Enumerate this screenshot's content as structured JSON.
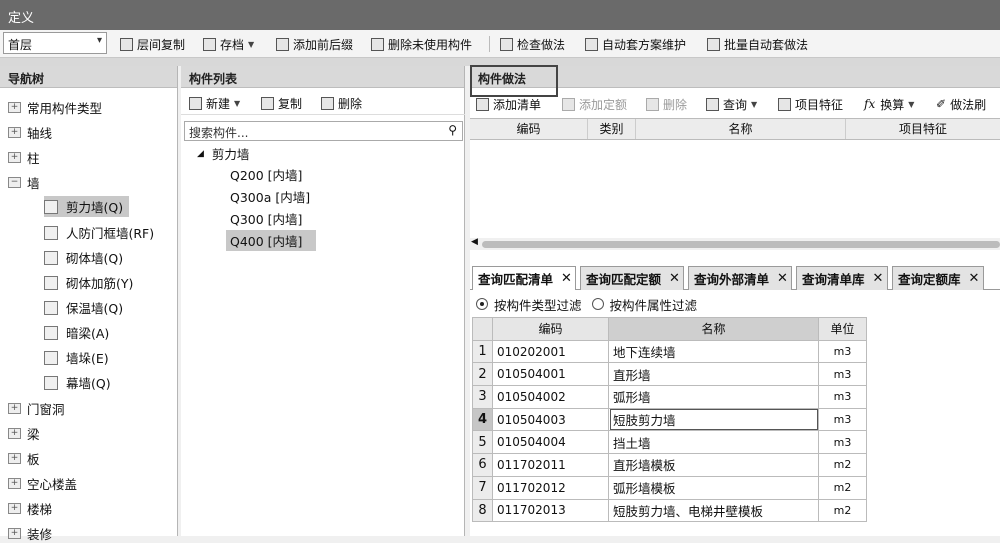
{
  "window": {
    "title": "定义"
  },
  "toolbar": {
    "floor": "首层",
    "items": [
      {
        "label": "层间复制",
        "dropdown": false
      },
      {
        "label": "存档",
        "dropdown": true
      },
      {
        "label": "添加前后缀",
        "dropdown": false
      },
      {
        "label": "删除未使用构件",
        "dropdown": false
      },
      {
        "label": "检查做法",
        "dropdown": false
      },
      {
        "label": "自动套方案维护",
        "dropdown": false
      },
      {
        "label": "批量自动套做法",
        "dropdown": false
      }
    ]
  },
  "nav": {
    "title": "导航树",
    "items": [
      {
        "label": "常用构件类型"
      },
      {
        "label": "轴线"
      },
      {
        "label": "柱"
      },
      {
        "label": "墙"
      },
      {
        "label": "剪力墙(Q)",
        "child": true,
        "selected": true
      },
      {
        "label": "人防门框墙(RF)",
        "child": true
      },
      {
        "label": "砌体墙(Q)",
        "child": true
      },
      {
        "label": "砌体加筋(Y)",
        "child": true
      },
      {
        "label": "保温墙(Q)",
        "child": true
      },
      {
        "label": "暗梁(A)",
        "child": true
      },
      {
        "label": "墙垛(E)",
        "child": true
      },
      {
        "label": "幕墙(Q)",
        "child": true
      },
      {
        "label": "门窗洞"
      },
      {
        "label": "梁"
      },
      {
        "label": "板"
      },
      {
        "label": "空心楼盖"
      },
      {
        "label": "楼梯"
      },
      {
        "label": "装修"
      }
    ]
  },
  "list": {
    "title": "构件列表",
    "toolbar": {
      "new": "新建",
      "copy": "复制",
      "delete": "删除"
    },
    "search_placeholder": "搜索构件...",
    "tree": {
      "group": "剪力墙",
      "items": [
        "Q200 [内墙]",
        "Q300a [内墙]",
        "Q300 [内墙]",
        "Q400 [内墙]"
      ],
      "selected_index": 3
    }
  },
  "method": {
    "title": "构件做法",
    "toolbar": {
      "add_bill": "添加清单",
      "add_quota": "添加定额",
      "delete": "删除",
      "query": "查询",
      "item_feature": "项目特征",
      "convert": "换算",
      "method_brush": "做法刷"
    },
    "columns": [
      "编码",
      "类别",
      "名称",
      "项目特征"
    ],
    "tabs": [
      {
        "label": "查询匹配清单",
        "active": true
      },
      {
        "label": "查询匹配定额",
        "active": false
      },
      {
        "label": "查询外部清单",
        "active": false
      },
      {
        "label": "查询清单库",
        "active": false
      },
      {
        "label": "查询定额库",
        "active": false
      }
    ],
    "filters": {
      "by_type": "按构件类型过滤",
      "by_attr": "按构件属性过滤",
      "selected": "by_type"
    },
    "query_table": {
      "headers": [
        "编码",
        "名称",
        "单位"
      ],
      "rows": [
        {
          "no": "1",
          "code": "010202001",
          "name": "地下连续墙",
          "unit": "m3"
        },
        {
          "no": "2",
          "code": "010504001",
          "name": "直形墙",
          "unit": "m3"
        },
        {
          "no": "3",
          "code": "010504002",
          "name": "弧形墙",
          "unit": "m3"
        },
        {
          "no": "4",
          "code": "010504003",
          "name": "短肢剪力墙",
          "unit": "m3"
        },
        {
          "no": "5",
          "code": "010504004",
          "name": "挡土墙",
          "unit": "m3"
        },
        {
          "no": "6",
          "code": "011702011",
          "name": "直形墙模板",
          "unit": "m2"
        },
        {
          "no": "7",
          "code": "011702012",
          "name": "弧形墙模板",
          "unit": "m2"
        },
        {
          "no": "8",
          "code": "011702013",
          "name": "短肢剪力墙、电梯井壁模板",
          "unit": "m2"
        }
      ],
      "current_row": 3
    }
  }
}
